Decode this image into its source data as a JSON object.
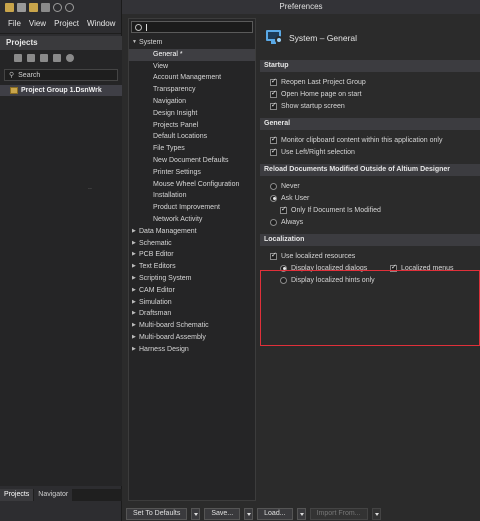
{
  "ide": {
    "menu": [
      "File",
      "View",
      "Project",
      "Window"
    ],
    "projects_title": "Projects",
    "search_placeholder": "Search",
    "project_item": "Project Group 1.DsnWrk",
    "dots": "..",
    "bottom_tabs": [
      "Projects",
      "Navigator"
    ]
  },
  "prefs": {
    "window_title": "Preferences",
    "tree": {
      "system": "System",
      "system_children": [
        "General *",
        "View",
        "Account Management",
        "Transparency",
        "Navigation",
        "Design Insight",
        "Projects Panel",
        "Default Locations",
        "File Types",
        "New Document Defaults",
        "Printer Settings",
        "Mouse Wheel Configuration",
        "Installation",
        "Product Improvement",
        "Network Activity"
      ],
      "other_nodes": [
        "Data Management",
        "Schematic",
        "PCB Editor",
        "Text Editors",
        "Scripting System",
        "CAM Editor",
        "Simulation",
        "Draftsman",
        "Multi-board Schematic",
        "Multi-board Assembly",
        "Harness Design"
      ]
    },
    "page_title": "System – General",
    "startup": {
      "header": "Startup",
      "reopen": "Reopen Last Project Group",
      "open_home": "Open Home page on start",
      "show_splash": "Show startup screen"
    },
    "general": {
      "header": "General",
      "monitor_clipboard": "Monitor clipboard content within this application only",
      "left_right": "Use Left/Right selection"
    },
    "reload": {
      "header": "Reload Documents Modified Outside of Altium Designer",
      "never": "Never",
      "ask_user": "Ask User",
      "only_modified": "Only If Document Is Modified",
      "always": "Always"
    },
    "localization": {
      "header": "Localization",
      "use_localized": "Use localized resources",
      "display_dialogs": "Display localized dialogs",
      "localized_menus": "Localized menus",
      "display_hints": "Display localized hints only"
    },
    "buttons": {
      "set_defaults": "Set To Defaults",
      "save": "Save...",
      "load": "Load...",
      "import_from": "Import From..."
    },
    "accent_highlight": "#e0303a"
  }
}
